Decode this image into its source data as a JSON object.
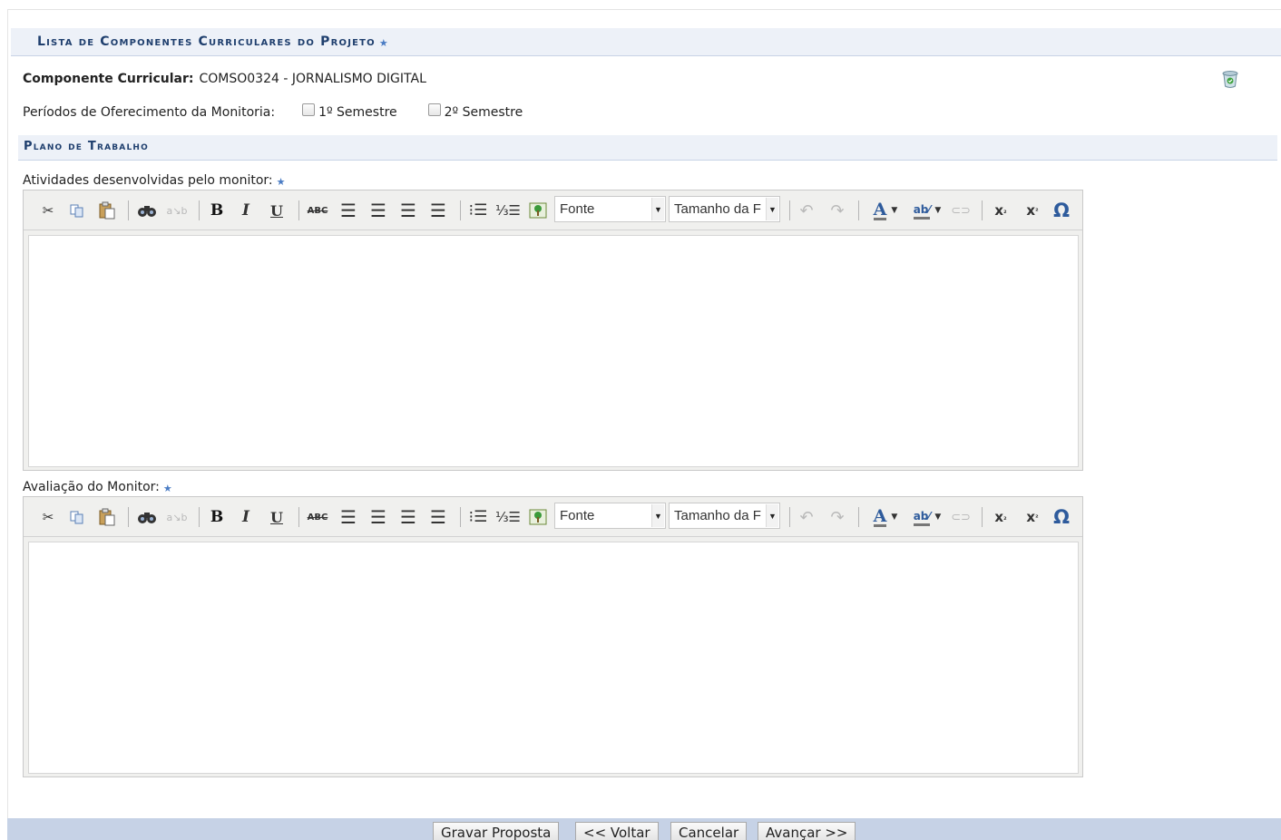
{
  "section": {
    "title": "Lista de Componentes Curriculares do Projeto"
  },
  "componente": {
    "label": "Componente Curricular:",
    "value": "COMSO0324 - JORNALISMO DIGITAL"
  },
  "periodos": {
    "label": "Períodos de Oferecimento da Monitoria:",
    "options": [
      {
        "label": "1º Semestre",
        "checked": false
      },
      {
        "label": "2º Semestre",
        "checked": false
      }
    ]
  },
  "plano": {
    "title": "Plano de Trabalho"
  },
  "fields": [
    {
      "label": "Atividades desenvolvidas pelo monitor:",
      "required": true,
      "content": ""
    },
    {
      "label": "Avaliação do Monitor:",
      "required": true,
      "content": ""
    }
  ],
  "editor_toolbar": {
    "font_select": "Fonte",
    "size_select": "Tamanho da F",
    "icons": [
      "cut-icon",
      "copy-icon",
      "paste-icon",
      "find-icon",
      "replace-icon",
      "bold-icon",
      "italic-icon",
      "underline-icon",
      "strikethrough-icon",
      "align-left-icon",
      "align-center-icon",
      "align-right-icon",
      "align-justify-icon",
      "bullet-list-icon",
      "numbered-list-icon",
      "image-icon",
      "undo-icon",
      "redo-icon",
      "text-color-icon",
      "highlight-color-icon",
      "link-icon",
      "subscript-icon",
      "superscript-icon",
      "special-char-icon"
    ]
  },
  "buttons": {
    "gravar": "Gravar Proposta",
    "voltar": "<< Voltar",
    "cancelar": "Cancelar",
    "avancar": "Avançar >>"
  },
  "colors": {
    "header_bg": "#edf1f8",
    "header_text": "#1f3f6e",
    "bottom_bar": "#c6d2e6",
    "required_star": "#4a7cc4"
  }
}
